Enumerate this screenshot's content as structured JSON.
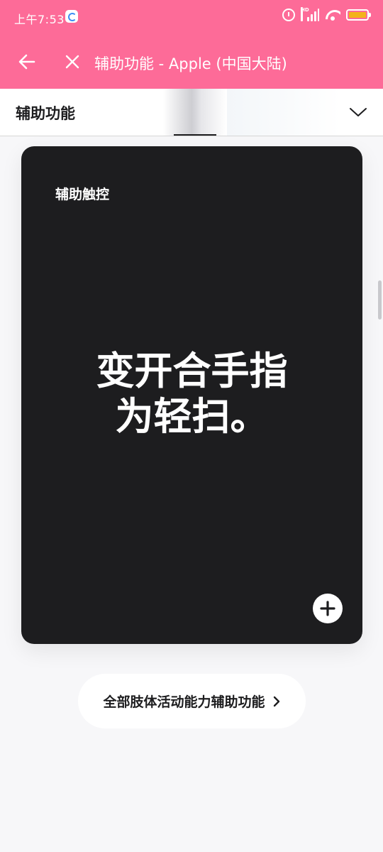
{
  "status_bar": {
    "time": "上午7:53",
    "network_label": "HD"
  },
  "app_bar": {
    "title": "辅助功能 - Apple (中国大陆)",
    "back_icon": "arrow-left-icon",
    "close_icon": "close-icon"
  },
  "local_nav": {
    "title": "辅助功能",
    "chevron_icon": "chevron-down-icon"
  },
  "card": {
    "eyebrow": "辅助触控",
    "headline_line1": "变开合手指",
    "headline_line2": "为轻扫。",
    "plus_icon": "plus-icon"
  },
  "link_pill": {
    "label": "全部肢体活动能力辅助功能",
    "chevron_icon": "chevron-right-icon"
  },
  "colors": {
    "app_bar": "#fd6b98",
    "card_bg": "#1d1d1f",
    "page_bg": "#f7f7f9",
    "battery": "#f3b21b"
  }
}
